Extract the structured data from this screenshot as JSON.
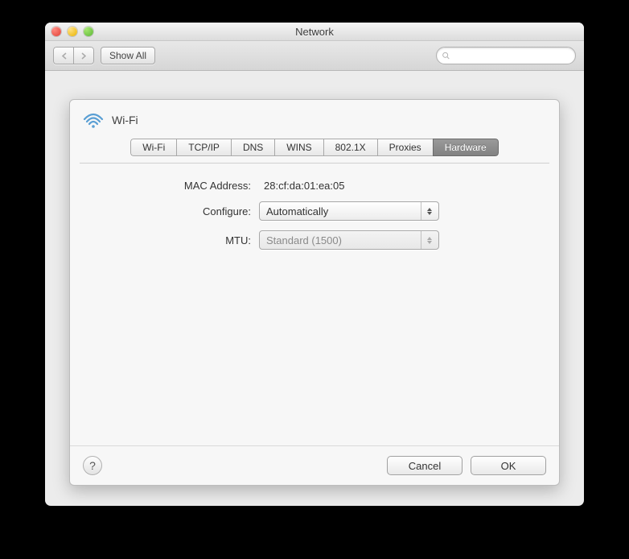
{
  "window": {
    "title": "Network"
  },
  "toolbar": {
    "show_all_label": "Show All",
    "search_placeholder": ""
  },
  "sheet": {
    "title": "Wi-Fi",
    "tabs": [
      {
        "label": "Wi-Fi"
      },
      {
        "label": "TCP/IP"
      },
      {
        "label": "DNS"
      },
      {
        "label": "WINS"
      },
      {
        "label": "802.1X"
      },
      {
        "label": "Proxies"
      },
      {
        "label": "Hardware"
      }
    ],
    "fields": {
      "mac_label": "MAC Address:",
      "mac_value": "28:cf:da:01:ea:05",
      "configure_label": "Configure:",
      "configure_value": "Automatically",
      "mtu_label": "MTU:",
      "mtu_value": "Standard  (1500)"
    },
    "buttons": {
      "help": "?",
      "cancel": "Cancel",
      "ok": "OK"
    }
  }
}
